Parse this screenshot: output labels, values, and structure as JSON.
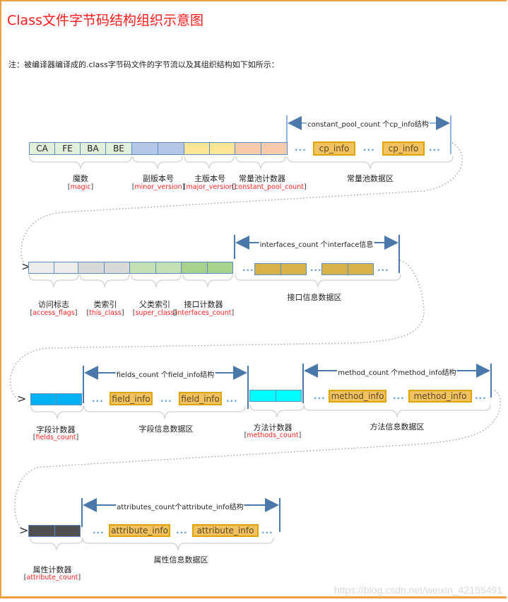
{
  "title": "Class文件字节码结构组织示意图",
  "note": "注：被编译器编译成的.class字节码文件的字节流以及其组织结构如下如所示：",
  "colors": {
    "magic": "#e2efda",
    "minor_version": "#b4c7e7",
    "major_version": "#ffe699",
    "constant_pool_count": "#f8cbad",
    "access_flags": "#ededed",
    "this_class": "#d9d9d9",
    "super_class": "#c5e0b4",
    "interfaces_count": "#a9d18e",
    "interface_item": "#d6b04a",
    "fields_count": "#00b0f0",
    "methods_count": "#00ffff",
    "attribute_count": "#505050",
    "info_fill": "#f2c160",
    "info_border": "#e0a400"
  },
  "row1": {
    "magic_bytes": [
      "CA",
      "FE",
      "BA",
      "BE"
    ],
    "fields": [
      {
        "name": "魔数",
        "id": "magic"
      },
      {
        "name": "副版本号",
        "id": "minor_version"
      },
      {
        "name": "主版本号",
        "id": "major_version"
      },
      {
        "name": "常量池计数器",
        "id": "constant_pool_count"
      }
    ],
    "span_label": "constant_pool_count 个cp_info结构",
    "info_items": [
      "cp_info",
      "cp_info"
    ],
    "ellipsis": "...",
    "region_label": "常量池数据区"
  },
  "row2": {
    "fields": [
      {
        "name": "访问标志",
        "id": "access_flags"
      },
      {
        "name": "类索引",
        "id": "this_class"
      },
      {
        "name": "父类索引",
        "id": "super_class"
      },
      {
        "name": "接口计数器",
        "id": "interfaces_count"
      }
    ],
    "span_label": "interfaces_count 个interface信息",
    "region_label": "接口信息数据区",
    "ellipsis": "..."
  },
  "row3": {
    "fields_counter": {
      "name": "字段计数器",
      "id": "fields_count"
    },
    "fields_span_label": "fields_count 个field_info结构",
    "field_items": [
      "field_info",
      "field_info"
    ],
    "fields_region_label": "字段信息数据区",
    "methods_counter": {
      "name": "方法计数器",
      "id": "methods_count"
    },
    "methods_span_label": "method_count 个method_info结构",
    "method_items": [
      "method_info",
      "method_info"
    ],
    "methods_region_label": "方法信息数据区",
    "ellipsis": "..."
  },
  "row4": {
    "attr_counter": {
      "name": "属性计数器",
      "id": "attribute_count"
    },
    "span_label": "attributes_count个attribute_info结构",
    "attr_items": [
      "attribute_info",
      "attribute_info"
    ],
    "region_label": "属性信息数据区",
    "ellipsis": "..."
  },
  "continuation_symbol": ">",
  "watermark": "https://blog.csdn.net/weixin_42155491"
}
